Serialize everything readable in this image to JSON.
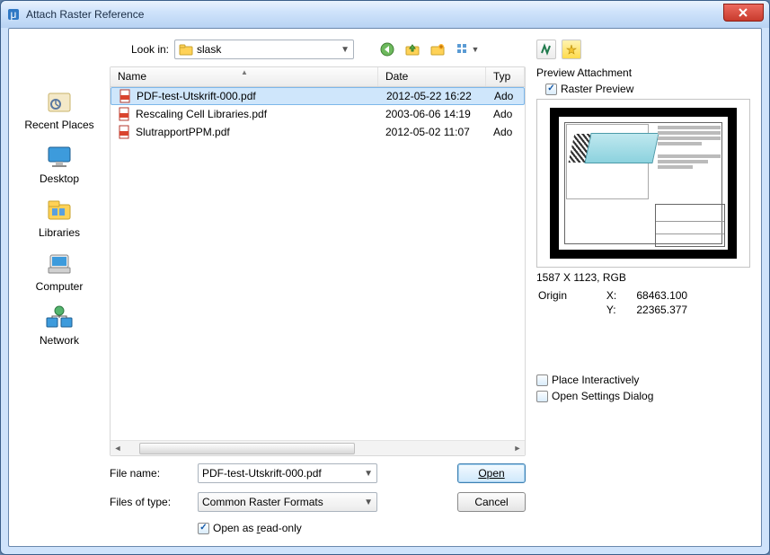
{
  "window": {
    "title": "Attach Raster Reference"
  },
  "lookin": {
    "label": "Look in:",
    "folder": "slask"
  },
  "toolbar_icons": [
    "back-icon",
    "up-icon",
    "new-folder-icon",
    "views-icon"
  ],
  "places": [
    {
      "label": "Recent Places"
    },
    {
      "label": "Desktop"
    },
    {
      "label": "Libraries"
    },
    {
      "label": "Computer"
    },
    {
      "label": "Network"
    }
  ],
  "columns": {
    "name": "Name",
    "date": "Date",
    "type": "Typ"
  },
  "files": [
    {
      "name": "PDF-test-Utskrift-000.pdf",
      "date": "2012-05-22 16:22",
      "type": "Ado",
      "selected": true
    },
    {
      "name": "Rescaling Cell Libraries.pdf",
      "date": "2003-06-06 14:19",
      "type": "Ado",
      "selected": false
    },
    {
      "name": "SlutrapportPPM.pdf",
      "date": "2012-05-02 11:07",
      "type": "Ado",
      "selected": false
    }
  ],
  "form": {
    "file_name_label": "File name:",
    "file_name_value": "PDF-test-Utskrift-000.pdf",
    "files_of_type_label": "Files of type:",
    "files_of_type_value": "Common Raster Formats",
    "open_label": "Open",
    "cancel_label": "Cancel",
    "readonly_label": "Open as read-only",
    "readonly_checked": true
  },
  "preview": {
    "group_label": "Preview Attachment",
    "raster_preview_label": "Raster Preview",
    "raster_preview_checked": true,
    "dimensions": "1587 X 1123, RGB",
    "origin_label": "Origin",
    "origin_x_label": "X:",
    "origin_x": "68463.100",
    "origin_y_label": "Y:",
    "origin_y": "22365.377"
  },
  "options": {
    "place_interactively_label": "Place Interactively",
    "place_interactively_checked": false,
    "open_settings_label": "Open Settings Dialog",
    "open_settings_checked": false
  }
}
